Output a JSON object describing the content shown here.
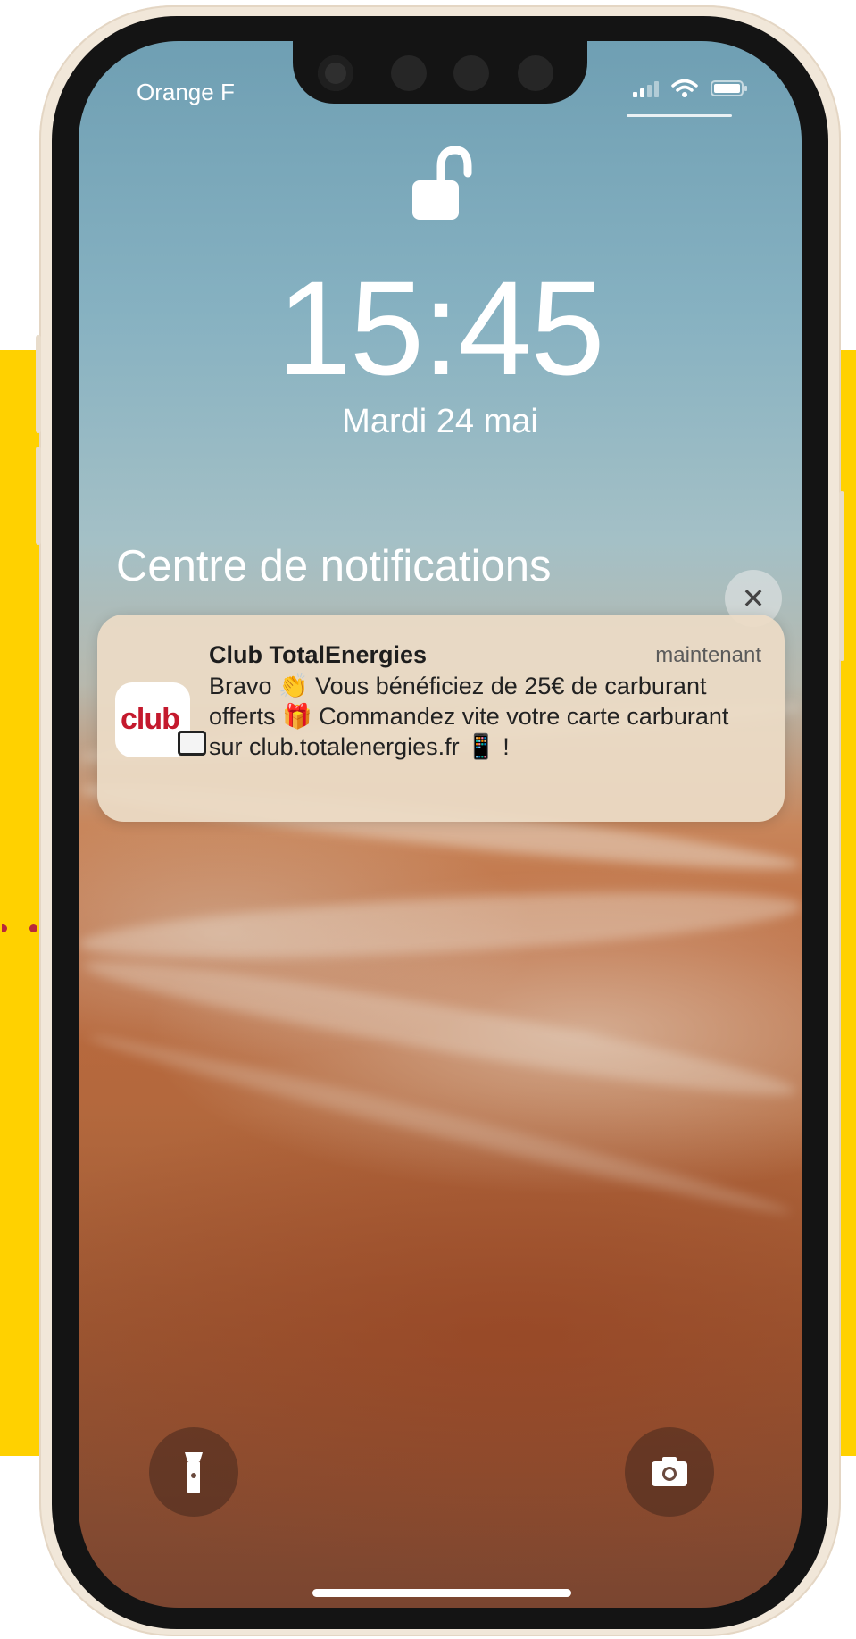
{
  "status_bar": {
    "carrier": "Orange F",
    "icons": [
      "signal-icon",
      "wifi-icon",
      "battery-icon"
    ]
  },
  "lockscreen": {
    "lock_icon": "unlocked-padlock-icon",
    "time": "15:45",
    "date": "Mardi 24 mai"
  },
  "notification_center": {
    "title": "Centre de notifications",
    "close_icon": "close-icon",
    "close_label": "✕"
  },
  "notification": {
    "app_name": "Club TotalEnergies",
    "timestamp": "maintenant",
    "icon_text": "club",
    "body": "Bravo 👏 Vous bénéficiez de 25€ de carburant offerts 🎁 Commandez vite votre carte carburant sur club.totalenergies.fr 📱 !"
  },
  "quick_actions": {
    "flashlight_icon": "flashlight-icon",
    "camera_icon": "camera-icon"
  },
  "colors": {
    "brand_yellow": "#FFD100",
    "brand_red": "#C4192D",
    "phone_frame": "#F1E7D9"
  }
}
